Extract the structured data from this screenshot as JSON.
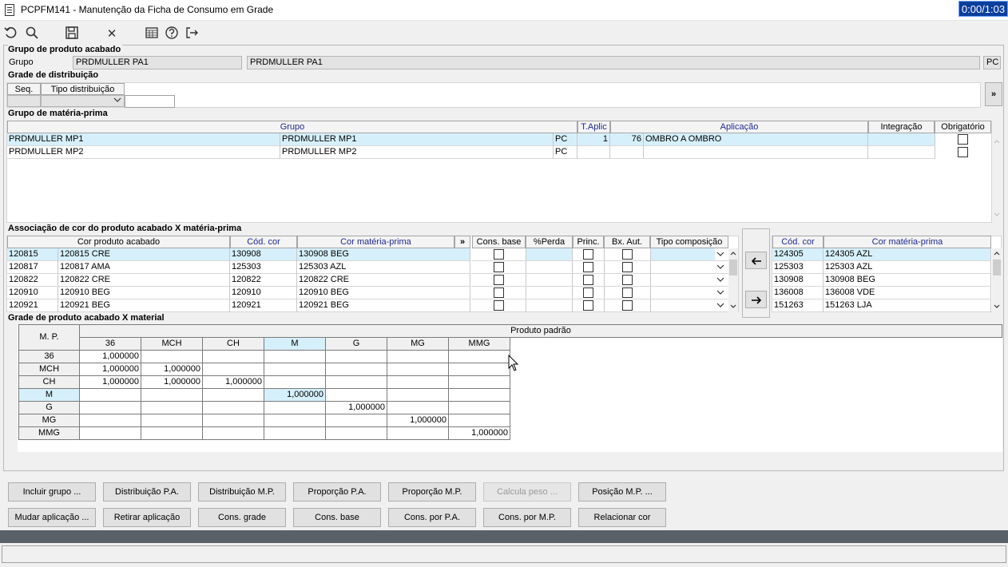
{
  "window": {
    "title": "PCPFM141 - Manutenção da Ficha de Consumo em Grade",
    "timer": "0:00/1:03"
  },
  "toolbar": {
    "icons": [
      "undo-icon",
      "search-icon",
      "save-icon",
      "close-icon",
      "calculator-icon",
      "help-icon",
      "exit-icon"
    ],
    "close_glyph": "✕"
  },
  "grupo_acabado": {
    "section": "Grupo de produto acabado",
    "label": "Grupo",
    "code": "PRDMULLER PA1",
    "description": "PRDMULLER PA1",
    "unit": "PC"
  },
  "grade_distribuicao": {
    "section": "Grade de distribuição",
    "col_seq": "Seq.",
    "col_tipo": "Tipo distribuição",
    "more_button": "»"
  },
  "materia_prima": {
    "section": "Grupo de matéria-prima",
    "headers": {
      "grupo": "Grupo",
      "taplic": "T.Aplic",
      "aplicacao": "Aplicação",
      "integracao": "Integração",
      "obrigatorio": "Obrigatório"
    },
    "rows": [
      {
        "code": "PRDMULLER MP1",
        "desc": "PRDMULLER MP1",
        "un": "PC",
        "taplic": "1",
        "apl_code": "76",
        "aplicacao": "OMBRO A OMBRO",
        "integracao": ""
      },
      {
        "code": "PRDMULLER MP2",
        "desc": "PRDMULLER MP2",
        "un": "PC",
        "taplic": "",
        "apl_code": "",
        "aplicacao": "",
        "integracao": ""
      }
    ]
  },
  "associacao": {
    "section": "Associação de cor do produto acabado X matéria-prima",
    "headers": {
      "cor_pa": "Cor produto acabado",
      "cod_cor": "Cód. cor",
      "cor_mp": "Cor matéria-prima",
      "more": "»",
      "cons_base": "Cons. base",
      "perda": "%Perda",
      "princ": "Princ.",
      "bx_aut": "Bx. Aut.",
      "tipo_comp": "Tipo composição"
    },
    "rows": [
      {
        "code": "120815",
        "desc": "120815 CRE",
        "cod": "130908",
        "cor": "130908 BEG"
      },
      {
        "code": "120817",
        "desc": "120817 AMA",
        "cod": "125303",
        "cor": "125303 AZL"
      },
      {
        "code": "120822",
        "desc": "120822 CRE",
        "cod": "120822",
        "cor": "120822 CRE"
      },
      {
        "code": "120910",
        "desc": "120910 BEG",
        "cod": "120910",
        "cor": "120910 BEG"
      },
      {
        "code": "120921",
        "desc": "120921 BEG",
        "cod": "120921",
        "cor": "120921 BEG"
      }
    ],
    "right_headers": {
      "cod_cor": "Cód. cor",
      "cor_mp": "Cor matéria-prima"
    },
    "right_rows": [
      {
        "cod": "124305",
        "cor": "124305 AZL"
      },
      {
        "cod": "125303",
        "cor": "125303 AZL"
      },
      {
        "cod": "130908",
        "cor": "130908 BEG"
      },
      {
        "cod": "136008",
        "cor": "136008 VDE"
      },
      {
        "cod": "151263",
        "cor": "151263 LJA"
      }
    ]
  },
  "grade_material": {
    "section": "Grade de produto acabado X material",
    "corner": "M. P.",
    "produto_padrao": "Produto padrão",
    "columns": [
      "36",
      "MCH",
      "CH",
      "M",
      "G",
      "MG",
      "MMG"
    ],
    "rows": [
      {
        "label": "36",
        "values": [
          "1,000000",
          "",
          "",
          "",
          "",
          "",
          ""
        ]
      },
      {
        "label": "MCH",
        "values": [
          "1,000000",
          "1,000000",
          "",
          "",
          "",
          "",
          ""
        ]
      },
      {
        "label": "CH",
        "values": [
          "1,000000",
          "1,000000",
          "1,000000",
          "",
          "",
          "",
          ""
        ]
      },
      {
        "label": "M",
        "values": [
          "",
          "",
          "",
          "1,000000",
          "",
          "",
          ""
        ]
      },
      {
        "label": "G",
        "values": [
          "",
          "",
          "",
          "",
          "1,000000",
          "",
          ""
        ]
      },
      {
        "label": "MG",
        "values": [
          "",
          "",
          "",
          "",
          "",
          "1,000000",
          ""
        ]
      },
      {
        "label": "MMG",
        "values": [
          "",
          "",
          "",
          "",
          "",
          "",
          "1,000000"
        ]
      }
    ]
  },
  "buttons": {
    "row1": [
      "Incluir grupo ...",
      "Distribuição P.A.",
      "Distribuição M.P.",
      "Proporção P.A.",
      "Proporção M.P.",
      "Calcula peso ...",
      "Posição M.P. ..."
    ],
    "row2": [
      "Mudar aplicação ...",
      "Retirar aplicação",
      "Cons. grade",
      "Cons. base",
      "Cons. por P.A.",
      "Cons. por M.P.",
      "Relacionar cor"
    ]
  },
  "colors": {
    "selection": "#d6f0fb",
    "header_text": "#1e2a8e",
    "timer_bg": "#0a3f9c"
  }
}
